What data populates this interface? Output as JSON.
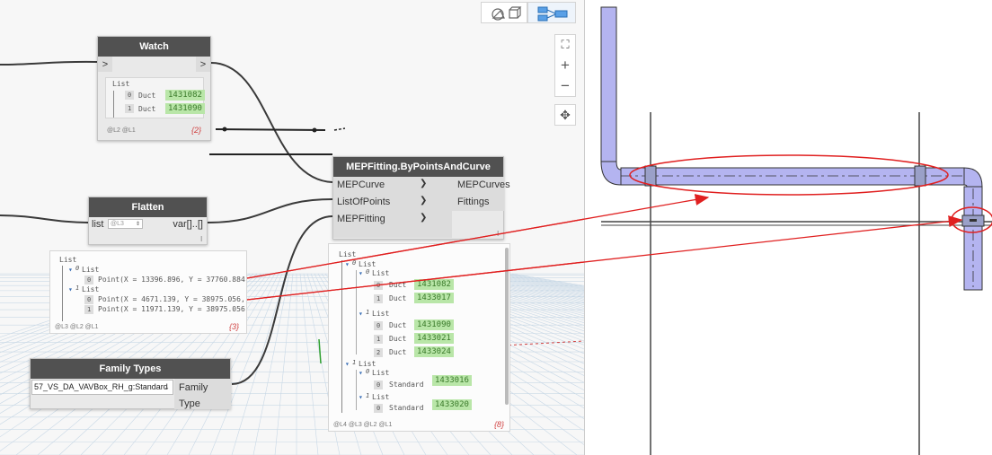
{
  "view_toggle": {
    "geometry_icon": "shapes-icon",
    "graph_icon": "graph-icon"
  },
  "zoom_controls": {
    "fit": "⛶",
    "zoom_in": "+",
    "zoom_out": "−",
    "pan": "✥"
  },
  "watch_node": {
    "title": "Watch",
    "in_port": ">",
    "out_port": ">",
    "list_header": "List",
    "items": [
      {
        "index": "0",
        "type": "Duct",
        "value": "1431082"
      },
      {
        "index": "1",
        "type": "Duct",
        "value": "1431090"
      }
    ],
    "levels": "@L2 @L1",
    "count": "{2}"
  },
  "flatten_node": {
    "title": "Flatten",
    "in_label": "list",
    "level": "@L3",
    "out_label": "var[]..[]"
  },
  "mep_node": {
    "title": "MEPFitting.ByPointsAndCurve",
    "inputs": [
      "MEPCurve",
      "ListOfPoints",
      "MEPFitting"
    ],
    "outputs": [
      "MEPCurves",
      "Fittings"
    ],
    "foot": "l"
  },
  "points_watch": {
    "list": "List",
    "sub0": "List",
    "sub0_index": "0",
    "sub0_item_index": "0",
    "sub0_item": "Point(X = 13396.896, Y = 37760.884",
    "sub1": "List",
    "sub1_index": "1",
    "sub1_items": [
      {
        "index": "0",
        "text": "Point(X = 4671.139, Y = 38975.056,"
      },
      {
        "index": "1",
        "text": "Point(X = 11971.139, Y = 38975.056"
      }
    ],
    "levels": "@L3 @L2 @L1",
    "count": "{3}"
  },
  "family_node": {
    "title": "Family Types",
    "selected": "57_VS_DA_VAVBox_RH_g:Standard",
    "out_label": "Family Type"
  },
  "mep_watch": {
    "list": "List",
    "groups": [
      {
        "index": "0",
        "label": "List",
        "sub": [
          {
            "index": "0",
            "label": "List",
            "items": [
              {
                "index": "0",
                "type": "Duct",
                "value": "1431082"
              },
              {
                "index": "1",
                "type": "Duct",
                "value": "1433017"
              }
            ]
          },
          {
            "index": "1",
            "label": "List",
            "items": [
              {
                "index": "0",
                "type": "Duct",
                "value": "1431090"
              },
              {
                "index": "1",
                "type": "Duct",
                "value": "1433021"
              },
              {
                "index": "2",
                "type": "Duct",
                "value": "1433024"
              }
            ]
          }
        ]
      },
      {
        "index": "1",
        "label": "List",
        "sub": [
          {
            "index": "0",
            "label": "List",
            "items": [
              {
                "index": "0",
                "type": "Standard",
                "value": "1433016"
              }
            ]
          },
          {
            "index": "1",
            "label": "List",
            "items": [
              {
                "index": "0",
                "type": "Standard",
                "value": "1433020"
              }
            ]
          }
        ]
      }
    ],
    "levels": "@L4 @L3 @L2 @L1",
    "count": "{8}"
  },
  "colors": {
    "node_header": "#515151",
    "value_green": "#b9e6a8",
    "duct_fill": "#b4b4f0",
    "annotation_red": "#e02020"
  }
}
